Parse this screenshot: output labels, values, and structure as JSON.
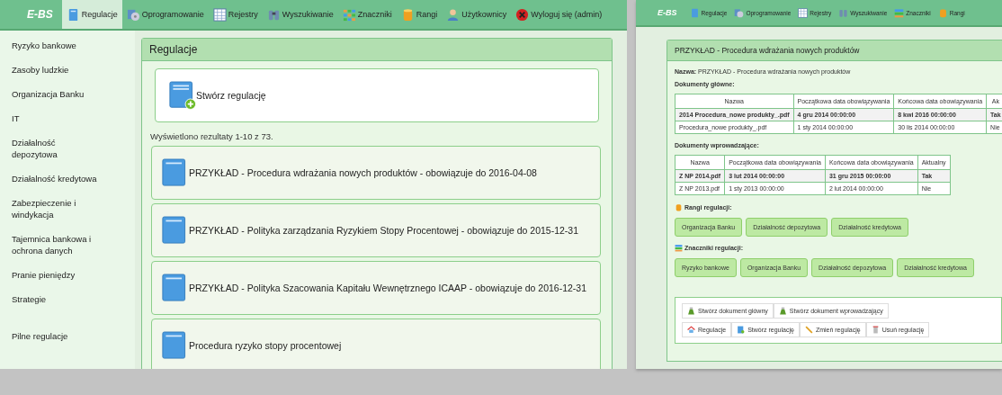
{
  "left": {
    "brand": "E-BS",
    "nav": [
      {
        "label": "Regulacje",
        "selected": true
      },
      {
        "label": "Oprogramowanie",
        "selected": false
      },
      {
        "label": "Rejestry",
        "selected": false
      },
      {
        "label": "Wyszukiwanie",
        "selected": false
      },
      {
        "label": "Znaczniki",
        "selected": false
      },
      {
        "label": "Rangi",
        "selected": false
      },
      {
        "label": "Użytkownicy",
        "selected": false
      },
      {
        "label": "Wyloguj się (admin)",
        "selected": false
      }
    ],
    "sidebar": {
      "items": [
        "Ryzyko bankowe",
        "Zasoby ludzkie",
        "Organizacja Banku",
        "IT",
        "Działalność depozytowa",
        "Działalność kredytowa",
        "Zabezpieczenie i windykacja",
        "Tajemnica bankowa i ochrona danych",
        "Pranie pieniędzy",
        "Strategie"
      ],
      "extra": "Pilne regulacje"
    },
    "panel": {
      "title": "Regulacje",
      "create": "Stwórz regulację",
      "results": "Wyświetlono rezultaty 1-10 z 73.",
      "items": [
        "PRZYKŁAD - Procedura wdrażania nowych produktów - obowiązuje do 2016-04-08",
        "PRZYKŁAD - Polityka zarządzania Ryzykiem Stopy Procentowej - obowiązuje do 2015-12-31",
        "PRZYKŁAD - Polityka Szacowania Kapitału Wewnętrznego ICAAP - obowiązuje do 2016-12-31",
        "Procedura ryzyko stopy procentowej"
      ]
    }
  },
  "right": {
    "brand": "E-BS",
    "nav": [
      {
        "label": "Regulacje",
        "selected": false
      },
      {
        "label": "Oprogramowanie",
        "selected": false
      },
      {
        "label": "Rejestry",
        "selected": false
      },
      {
        "label": "Wyszukiwanie",
        "selected": false
      },
      {
        "label": "Znaczniki",
        "selected": false
      },
      {
        "label": "Rangi",
        "selected": false
      }
    ],
    "panel": {
      "title": "PRZYKŁAD - Procedura wdrażania nowych produktów",
      "name_label": "Nazwa:",
      "name_value": "PRZYKŁAD - Procedura wdrażania nowych produktów",
      "main_docs": {
        "title": "Dokumenty główne:",
        "columns": [
          "Nazwa",
          "Początkowa data obowiązywania",
          "Końcowa data obowiązywania",
          "Ak"
        ],
        "rows": [
          {
            "current": true,
            "cells": [
              "2014 Procedura_nowe produkty_.pdf",
              "4 gru 2014 00:00:00",
              "8 kwi 2016 00:00:00",
              "Tak"
            ]
          },
          {
            "current": false,
            "cells": [
              "Procedura_nowe produkty_.pdf",
              "1 sty 2014 00:00:00",
              "30 lis 2014 00:00:00",
              "Nie"
            ]
          }
        ]
      },
      "intro_docs": {
        "title": "Dokumenty wprowadzające:",
        "columns": [
          "Nazwa",
          "Początkowa data obowiązywania",
          "Końcowa data obowiązywania",
          "Aktualny"
        ],
        "rows": [
          {
            "current": true,
            "cells": [
              "Z NP 2014.pdf",
              "3 lut 2014 00:00:00",
              "31 gru 2015 00:00:00",
              "Tak"
            ]
          },
          {
            "current": false,
            "cells": [
              "Z NP 2013.pdf",
              "1 sty 2013 00:00:00",
              "2 lut 2014 00:00:00",
              "Nie"
            ]
          }
        ]
      },
      "ranks": {
        "title": "Rangi regulacji:",
        "tags": [
          "Organizacja Banku",
          "Działalność depozytowa",
          "Działalność kredytowa"
        ]
      },
      "markers": {
        "title": "Znaczniki regulacji:",
        "tags": [
          "Ryzyko bankowe",
          "Organizacja Banku",
          "Działalność depozytowa",
          "Działalność kredytowa"
        ]
      },
      "actions": [
        [
          "Stwórz dokument główny",
          "Stwórz dokument wprowadzający"
        ],
        [
          "Regulacje",
          "Stwórz regulację",
          "Zmień regulację",
          "Usuń regulację"
        ]
      ]
    }
  }
}
